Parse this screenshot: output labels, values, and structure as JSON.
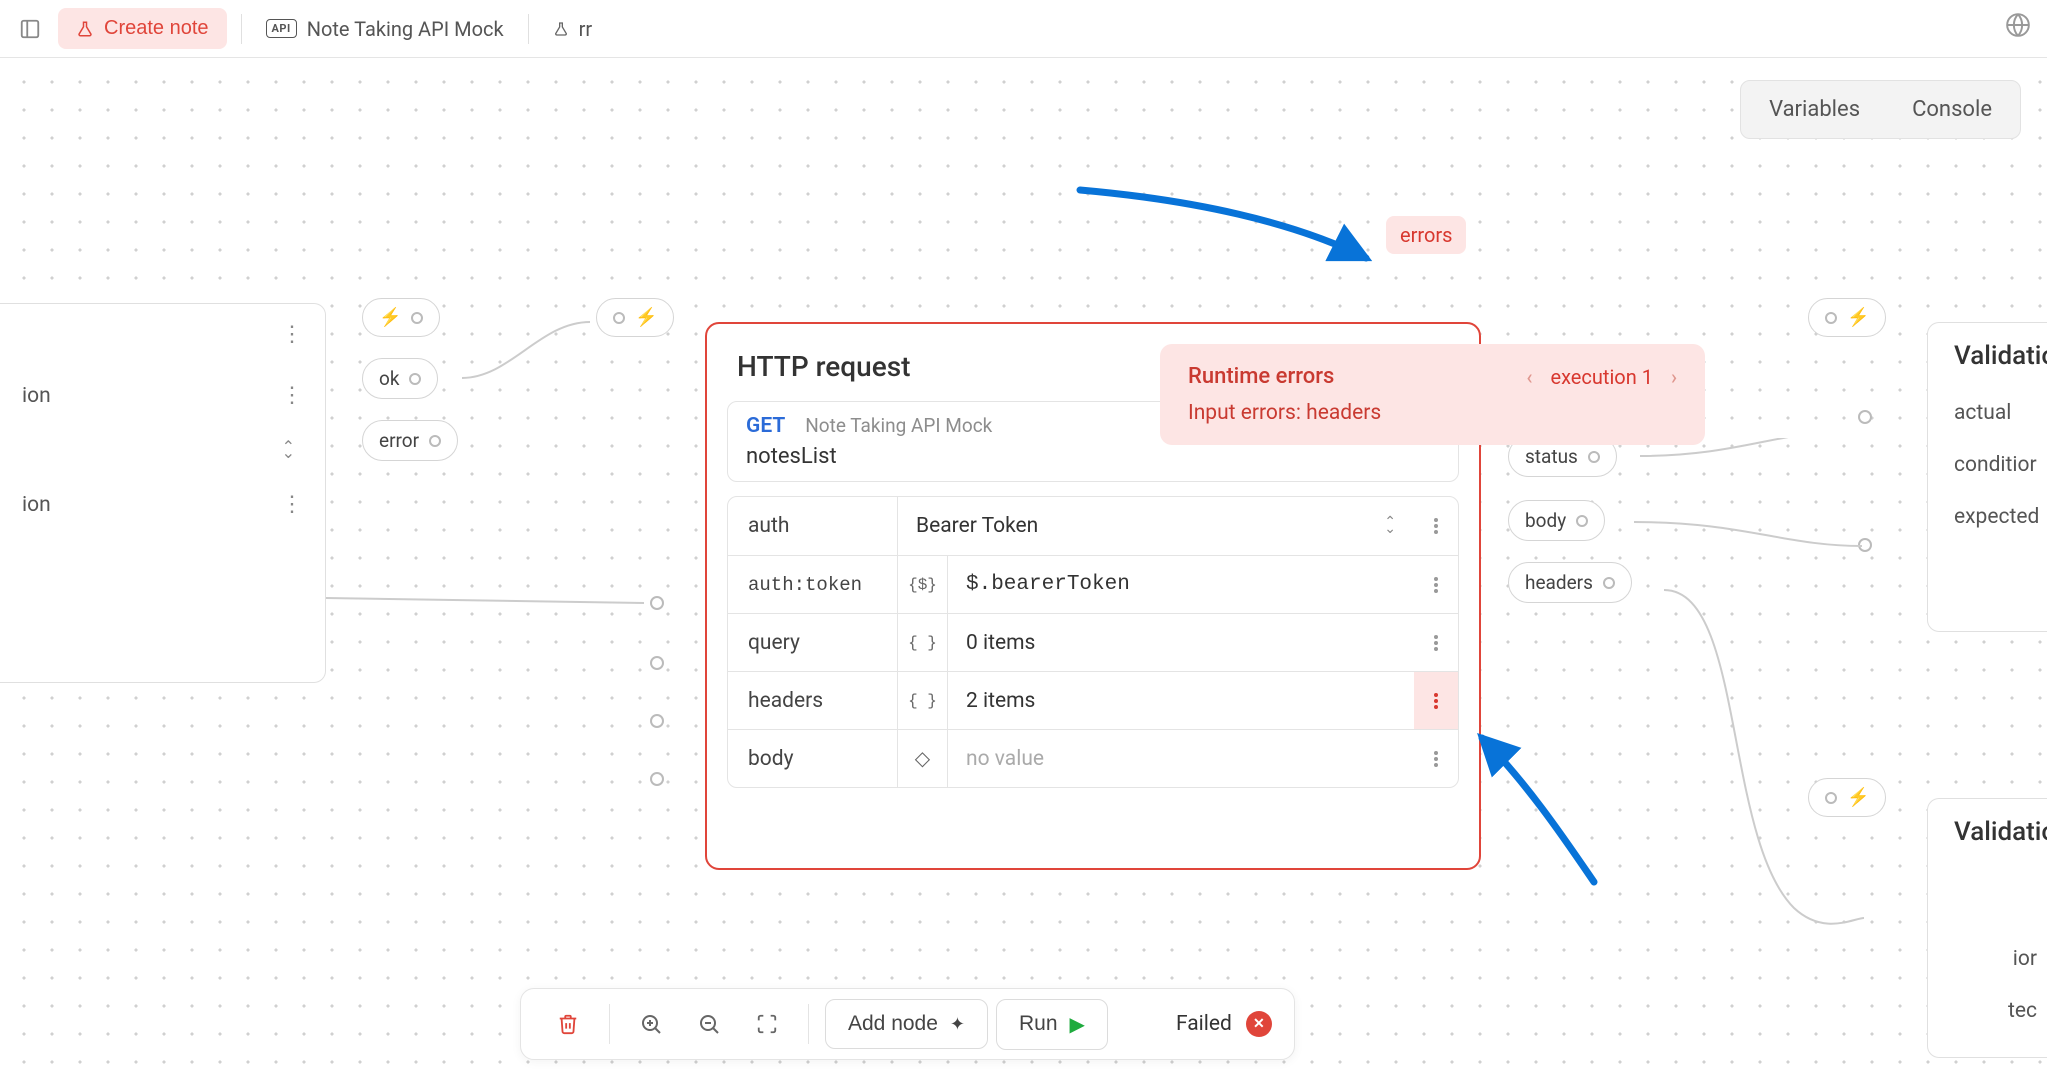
{
  "toolbar": {
    "create_note": "Create note",
    "breadcrumb_api": "Note Taking API Mock",
    "breadcrumb_scenario": "rr"
  },
  "topRight": {
    "variables": "Variables",
    "console": "Console"
  },
  "leftPanel": {
    "row1": "ion",
    "row2": "ion"
  },
  "chips": {
    "ok": "ok",
    "error": "error",
    "status": "status",
    "body": "body",
    "headers": "headers"
  },
  "errorsBadge": "errors",
  "httpNode": {
    "title": "HTTP request",
    "method": "GET",
    "api": "Note Taking API Mock",
    "operation": "notesList",
    "rows": [
      {
        "label": "auth",
        "icon": "",
        "value": "Bearer Token",
        "select": true
      },
      {
        "label": "auth:token",
        "icon": "{$}",
        "value": "$.bearerToken",
        "mono": true
      },
      {
        "label": "query",
        "icon": "{ }",
        "value": "0 items"
      },
      {
        "label": "headers",
        "icon": "{ }",
        "value": "2 items",
        "error": true
      },
      {
        "label": "body",
        "icon": "◇",
        "value": "no value",
        "muted": true
      }
    ]
  },
  "runtime": {
    "title": "Runtime errors",
    "execution": "execution 1",
    "message": "Input errors: headers"
  },
  "rightPanels": [
    {
      "title": "Validatio",
      "rows": [
        "actual",
        "conditior",
        "expected"
      ]
    },
    {
      "title": "Validatio",
      "rows": [
        "ior",
        "tec"
      ]
    }
  ],
  "bottomBar": {
    "addNode": "Add node",
    "run": "Run",
    "status": "Failed"
  }
}
